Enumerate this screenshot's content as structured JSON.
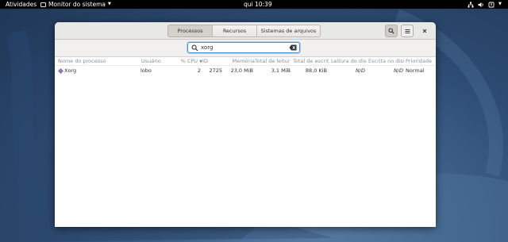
{
  "colors": {
    "wallpaper": "#3f628b",
    "topbar": "#000000",
    "window_bg": "#ffffff",
    "headerbar": "#e8e8e7",
    "search_focus": "#4a90d9"
  },
  "topbar": {
    "activities": "Atividades",
    "app_menu": "Monitor do sistema",
    "clock": "qui 10:39",
    "tray_icons": [
      "network-icon",
      "volume-icon",
      "power-icon"
    ]
  },
  "headerbar": {
    "tabs": [
      {
        "label": "Processos",
        "active": true
      },
      {
        "label": "Recursos",
        "active": false
      },
      {
        "label": "Sistemas de arquivos",
        "active": false
      }
    ],
    "buttons": [
      "search-icon",
      "menu-icon",
      "close-icon"
    ]
  },
  "search": {
    "value": "xorg"
  },
  "table": {
    "columns": [
      "Nome do processo",
      "Usuário",
      "% CPU",
      "ID",
      "Memória",
      "Total de leitur",
      "Total de escrit",
      "Leitura do disc",
      "Escrita no disc",
      "Prioridade"
    ],
    "sort_column": "% CPU",
    "rows": [
      {
        "name": "Xorg",
        "user": "lobo",
        "cpu": "2",
        "id": "2725",
        "memory": "23,0 MiB",
        "disk_read_total": "3,1 MiB",
        "disk_write_total": "88,0 KiB",
        "disk_read": "N/D",
        "disk_write": "N/D",
        "priority": "Normal"
      }
    ]
  }
}
